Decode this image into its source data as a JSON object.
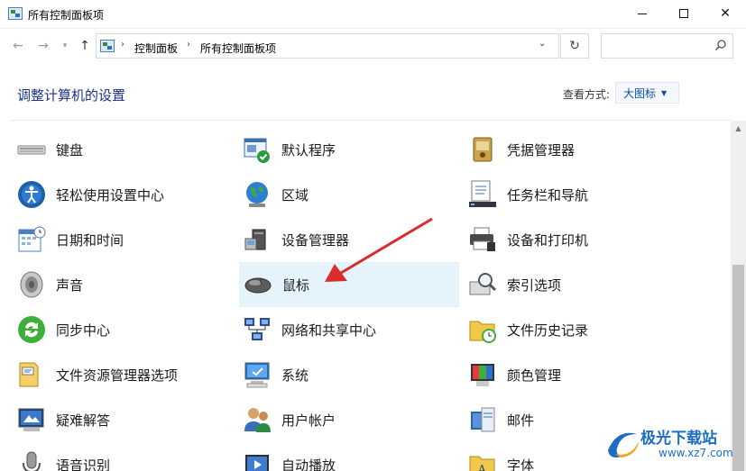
{
  "window": {
    "title": "所有控制面板项",
    "minimize": "─",
    "maximize": "☐",
    "close": "✕"
  },
  "address_bar": {
    "crumbs": [
      "控制面板",
      "所有控制面板项"
    ],
    "search_placeholder": ""
  },
  "header": {
    "heading": "调整计算机的设置",
    "view_by_label": "查看方式:",
    "view_by_value": "大图标"
  },
  "items": [
    {
      "label": "键盘",
      "icon": "keyboard-icon"
    },
    {
      "label": "默认程序",
      "icon": "default-programs-icon"
    },
    {
      "label": "凭据管理器",
      "icon": "credential-manager-icon"
    },
    {
      "label": "轻松使用设置中心",
      "icon": "ease-of-access-icon"
    },
    {
      "label": "区域",
      "icon": "region-globe-icon"
    },
    {
      "label": "任务栏和导航",
      "icon": "taskbar-icon"
    },
    {
      "label": "日期和时间",
      "icon": "date-time-icon"
    },
    {
      "label": "设备管理器",
      "icon": "device-manager-icon"
    },
    {
      "label": "设备和打印机",
      "icon": "printer-icon"
    },
    {
      "label": "声音",
      "icon": "speaker-icon"
    },
    {
      "label": "鼠标",
      "icon": "mouse-icon"
    },
    {
      "label": "索引选项",
      "icon": "indexing-icon"
    },
    {
      "label": "同步中心",
      "icon": "sync-icon"
    },
    {
      "label": "网络和共享中心",
      "icon": "network-icon"
    },
    {
      "label": "文件历史记录",
      "icon": "file-history-icon"
    },
    {
      "label": "文件资源管理器选项",
      "icon": "folder-options-icon"
    },
    {
      "label": "系统",
      "icon": "system-icon"
    },
    {
      "label": "颜色管理",
      "icon": "color-management-icon"
    },
    {
      "label": "疑难解答",
      "icon": "troubleshooting-icon"
    },
    {
      "label": "用户帐户",
      "icon": "user-accounts-icon"
    },
    {
      "label": "邮件",
      "icon": "mail-icon"
    },
    {
      "label": "语音识别",
      "icon": "microphone-icon"
    },
    {
      "label": "自动播放",
      "icon": "autoplay-icon"
    },
    {
      "label": "字体",
      "icon": "fonts-icon"
    }
  ],
  "selected_item": "鼠标",
  "watermark": {
    "name_cn": "极光下载站",
    "url": "www.xz7.com"
  },
  "colors": {
    "heading": "#1e3287",
    "selection": "#e5f3fb",
    "annotation_arrow": "#d92c2c",
    "watermark": "#1b6ec2"
  }
}
